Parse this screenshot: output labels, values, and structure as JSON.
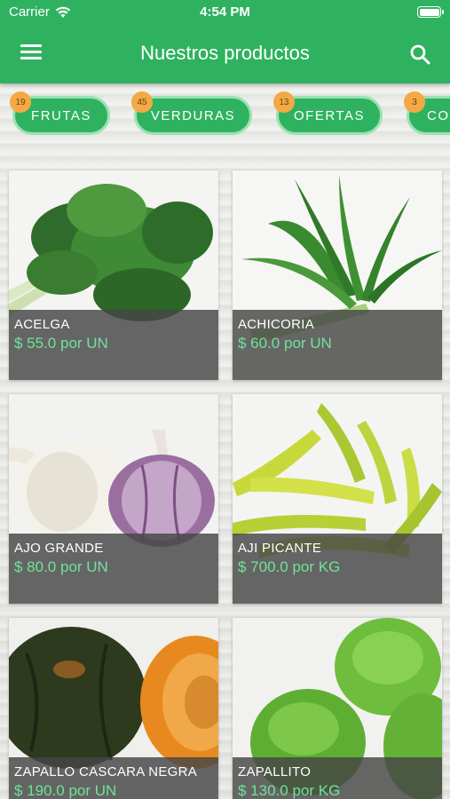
{
  "status_bar": {
    "carrier": "Carrier",
    "time": "4:54 PM"
  },
  "header": {
    "title": "Nuestros productos",
    "menu_icon": "hamburger-menu-icon",
    "search_icon": "search-icon"
  },
  "colors": {
    "primary": "#2fb25f",
    "badge": "#f4a944",
    "price": "#6fe39a"
  },
  "categories": [
    {
      "label": "FRUTAS",
      "count": "19"
    },
    {
      "label": "VERDURAS",
      "count": "45"
    },
    {
      "label": "OFERTAS",
      "count": "13"
    },
    {
      "label": "CO",
      "count": "3"
    }
  ],
  "products": [
    {
      "name": "ACELGA",
      "price": "$ 55.0 por UN"
    },
    {
      "name": "ACHICORIA",
      "price": "$ 60.0 por UN"
    },
    {
      "name": "AJO GRANDE",
      "price": "$ 80.0 por UN"
    },
    {
      "name": "AJI PICANTE",
      "price": "$ 700.0 por KG"
    },
    {
      "name": "ZAPALLO CASCARA NEGRA",
      "price": "$ 190.0 por UN"
    },
    {
      "name": "ZAPALLITO",
      "price": "$ 130.0 por KG"
    }
  ]
}
